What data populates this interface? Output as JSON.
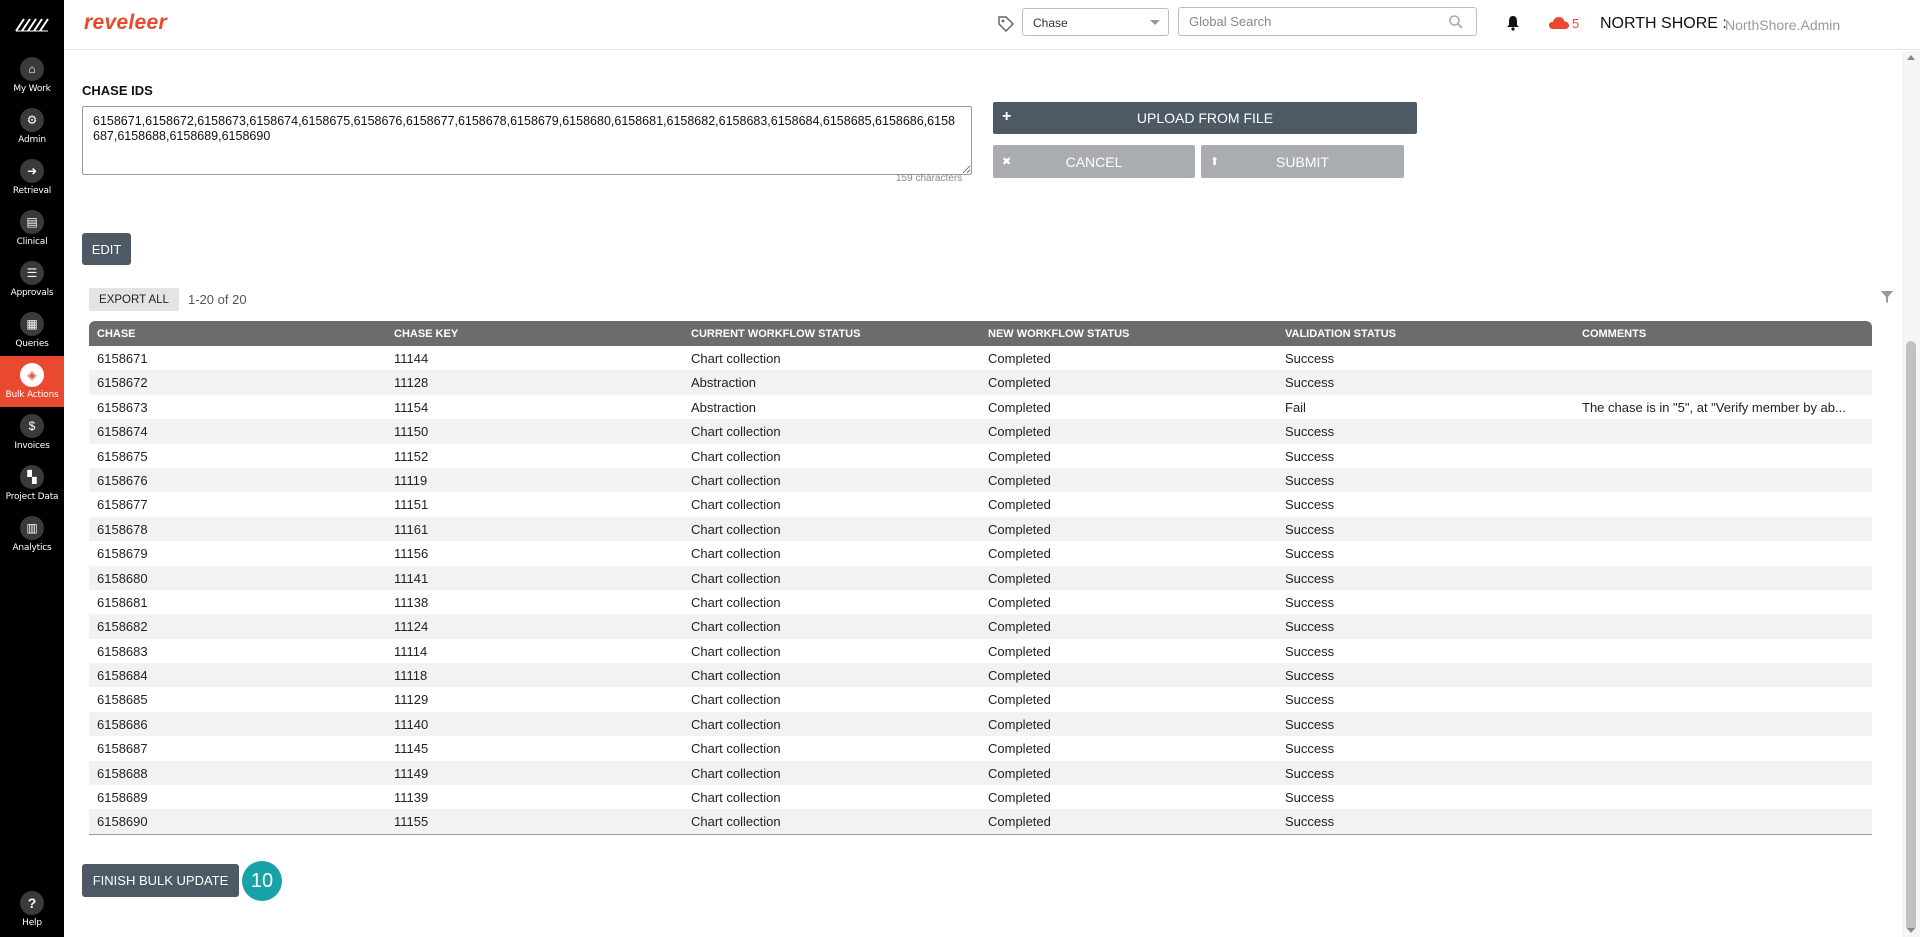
{
  "brand": "reveleer",
  "header": {
    "chase_select": "Chase",
    "search_placeholder": "Global Search",
    "cloud_count": "5",
    "org": "NORTH SHORE :",
    "user": "NorthShore.Admin"
  },
  "sidebar": {
    "items": [
      {
        "label": "My Work",
        "icon": "home-icon"
      },
      {
        "label": "Admin",
        "icon": "gear-icon"
      },
      {
        "label": "Retrieval",
        "icon": "arrow-right-icon"
      },
      {
        "label": "Clinical",
        "icon": "clipboard-icon"
      },
      {
        "label": "Approvals",
        "icon": "list-icon"
      },
      {
        "label": "Queries",
        "icon": "document-icon"
      },
      {
        "label": "Bulk Actions",
        "icon": "layers-icon"
      },
      {
        "label": "Invoices",
        "icon": "dollar-icon"
      },
      {
        "label": "Project Data",
        "icon": "grid-icon"
      },
      {
        "label": "Analytics",
        "icon": "bar-chart-icon"
      }
    ],
    "help": "Help",
    "active_color": "#e8492f"
  },
  "form": {
    "chase_ids_label": "CHASE IDS",
    "chase_ids_value": "6158671,6158672,6158673,6158674,6158675,6158676,6158677,6158678,6158679,6158680,6158681,6158682,6158683,6158684,6158685,6158686,6158687,6158688,6158689,6158690",
    "char_count": "159 characters",
    "upload_label": "UPLOAD FROM FILE",
    "cancel_label": "CANCEL",
    "submit_label": "SUBMIT",
    "edit_label": "EDIT"
  },
  "grid": {
    "export_label": "EXPORT ALL",
    "pager": "1-20  of  20",
    "columns": [
      "CHASE",
      "CHASE KEY",
      "CURRENT WORKFLOW STATUS",
      "NEW WORKFLOW STATUS",
      "VALIDATION STATUS",
      "COMMENTS"
    ],
    "rows": [
      [
        "6158671",
        "11144",
        "Chart collection",
        "Completed",
        "Success",
        ""
      ],
      [
        "6158672",
        "11128",
        "Abstraction",
        "Completed",
        "Success",
        ""
      ],
      [
        "6158673",
        "11154",
        "Abstraction",
        "Completed",
        "Fail",
        "The chase is in \"5\", at \"Verify member by ab..."
      ],
      [
        "6158674",
        "11150",
        "Chart collection",
        "Completed",
        "Success",
        ""
      ],
      [
        "6158675",
        "11152",
        "Chart collection",
        "Completed",
        "Success",
        ""
      ],
      [
        "6158676",
        "11119",
        "Chart collection",
        "Completed",
        "Success",
        ""
      ],
      [
        "6158677",
        "11151",
        "Chart collection",
        "Completed",
        "Success",
        ""
      ],
      [
        "6158678",
        "11161",
        "Chart collection",
        "Completed",
        "Success",
        ""
      ],
      [
        "6158679",
        "11156",
        "Chart collection",
        "Completed",
        "Success",
        ""
      ],
      [
        "6158680",
        "11141",
        "Chart collection",
        "Completed",
        "Success",
        ""
      ],
      [
        "6158681",
        "11138",
        "Chart collection",
        "Completed",
        "Success",
        ""
      ],
      [
        "6158682",
        "11124",
        "Chart collection",
        "Completed",
        "Success",
        ""
      ],
      [
        "6158683",
        "11114",
        "Chart collection",
        "Completed",
        "Success",
        ""
      ],
      [
        "6158684",
        "11118",
        "Chart collection",
        "Completed",
        "Success",
        ""
      ],
      [
        "6158685",
        "11129",
        "Chart collection",
        "Completed",
        "Success",
        ""
      ],
      [
        "6158686",
        "11140",
        "Chart collection",
        "Completed",
        "Success",
        ""
      ],
      [
        "6158687",
        "11145",
        "Chart collection",
        "Completed",
        "Success",
        ""
      ],
      [
        "6158688",
        "11149",
        "Chart collection",
        "Completed",
        "Success",
        ""
      ],
      [
        "6158689",
        "11139",
        "Chart collection",
        "Completed",
        "Success",
        ""
      ],
      [
        "6158690",
        "11155",
        "Chart collection",
        "Completed",
        "Success",
        ""
      ]
    ]
  },
  "footer": {
    "finish_label": "FINISH BULK UPDATE",
    "step_badge": "10"
  }
}
